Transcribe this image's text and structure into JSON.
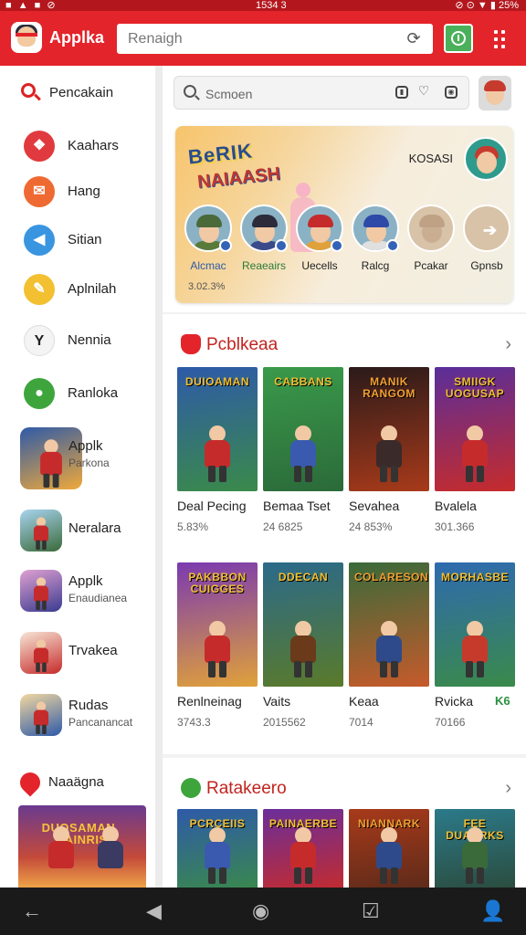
{
  "status": {
    "left": "■ ▲ ■ ⊘",
    "time": "1534 3",
    "right": "⊘ ⊙ ▼ ▮ 25%"
  },
  "header": {
    "app_name": "Applka",
    "search_placeholder": "Renaigh",
    "refresh_icon": "refresh-icon",
    "download_icon": "download-clock-icon",
    "menu_icon": "more-grid-icon",
    "accent": "#e3242b"
  },
  "sidebar": {
    "search_label": "Pencakain",
    "items": [
      {
        "label": "Kaahars",
        "icon": "❖",
        "color": "#e03a3e"
      },
      {
        "label": "Hang",
        "icon": "✉",
        "color": "#ef6a32"
      },
      {
        "label": "Sitian",
        "icon": "◀",
        "color": "#3a95e0"
      },
      {
        "label": "Aplnilah",
        "icon": "✎",
        "color": "#f2c031"
      },
      {
        "label": "Nennia",
        "icon": "Y",
        "color": "#f4f4f4"
      },
      {
        "label": "Ranloka",
        "icon": "●",
        "color": "#3da53c"
      }
    ],
    "apps": [
      {
        "label": "Applk",
        "sub": "Parkona"
      },
      {
        "label": "Neralara",
        "sub": ""
      },
      {
        "label": "Applk",
        "sub": "Enaudianea"
      },
      {
        "label": "Trvakea",
        "sub": ""
      },
      {
        "label": "Rudas",
        "sub": "Pancanancat"
      }
    ],
    "news_label": "Naaägna"
  },
  "main": {
    "search_placeholder": "Scmoen",
    "hero": {
      "title_1": "BeRIK",
      "title_2": "NAIAASH",
      "right_label": "KOSASI",
      "stat": "3.02.3%",
      "creators": [
        {
          "name": "Alcmac"
        },
        {
          "name": "Reaeairs"
        },
        {
          "name": "Uecells"
        },
        {
          "name": "Ralcg"
        },
        {
          "name": "Pcakar"
        },
        {
          "name": "Gpnsb"
        }
      ]
    },
    "popular": {
      "title": "Pcblkeaa",
      "rows": [
        [
          {
            "art_title": "DUIOAMAN",
            "name": "Deal Pecing",
            "meta": "5.83%"
          },
          {
            "art_title": "CABBANS",
            "name": "Bemaa Tset",
            "meta": "24 6825"
          },
          {
            "art_title": "MANIK RANGOM",
            "name": "Sevahea",
            "meta": "24 853%"
          },
          {
            "art_title": "SMIIGK UOGUSAP",
            "name": "Bvalela",
            "meta": "301.366"
          }
        ],
        [
          {
            "art_title": "PAKBBON CUIGGES",
            "name": "Renlneinag",
            "meta": "3743.3"
          },
          {
            "art_title": "DDECAN",
            "name": "Vaits",
            "meta": "2015562"
          },
          {
            "art_title": "COLARESON",
            "name": "Keaa",
            "meta": "7014"
          },
          {
            "art_title": "MORHASBE",
            "name": "Rvicka",
            "meta": "70166"
          }
        ]
      ],
      "edge_label": "K6"
    },
    "ratings": {
      "title": "Ratakeero",
      "cards": [
        {
          "art_title": "PCRCEIIS"
        },
        {
          "art_title": "PAINAERBE"
        },
        {
          "art_title": "NIANNARK"
        },
        {
          "art_title": "FEE DUARRKS"
        }
      ]
    }
  },
  "navbar": {
    "back": "←",
    "home": "◉",
    "recents": "◀",
    "tasks": "☑",
    "profile": "👤"
  }
}
